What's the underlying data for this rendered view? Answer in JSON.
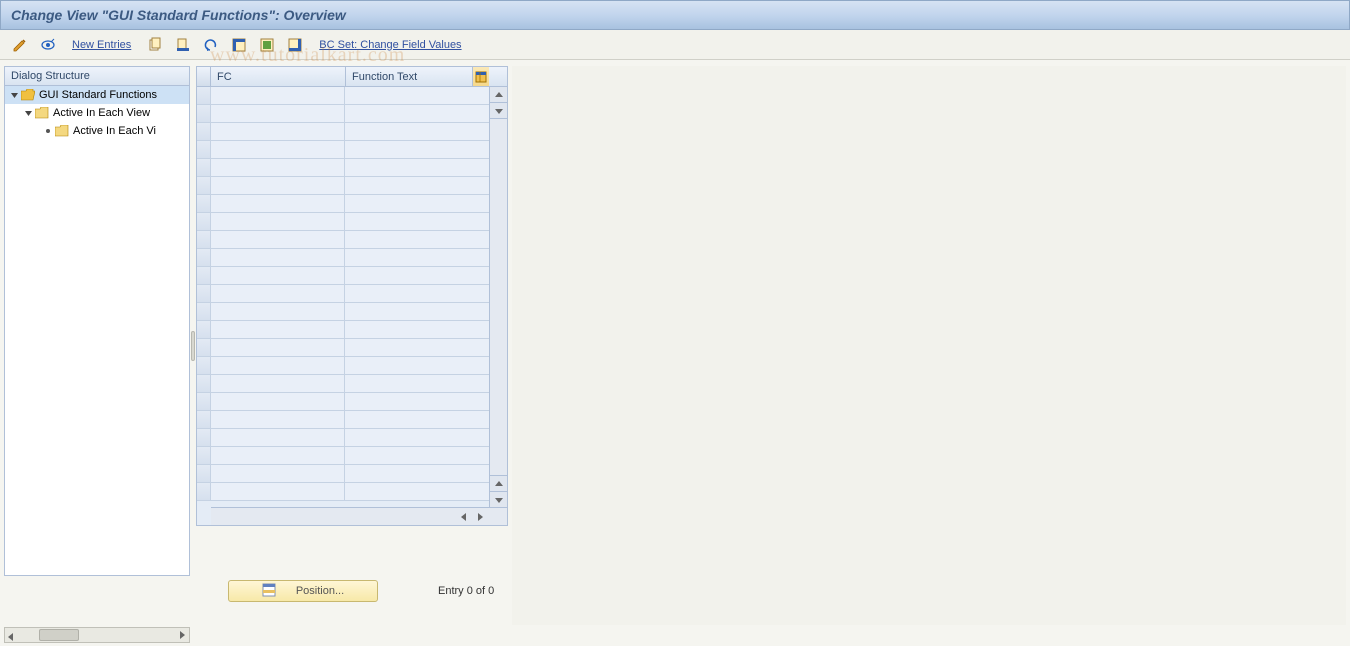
{
  "title": "Change View \"GUI Standard Functions\": Overview",
  "toolbar": {
    "new_entries": "New Entries",
    "bc_set": "BC Set: Change Field Values"
  },
  "tree": {
    "header": "Dialog Structure",
    "nodes": {
      "root": "GUI Standard Functions",
      "child1": "Active In Each View",
      "child2": "Active In Each Vi"
    }
  },
  "grid": {
    "col_fc": "FC",
    "col_ft": "Function Text"
  },
  "footer": {
    "position_btn": "Position...",
    "entry_text": "Entry 0 of 0"
  },
  "watermark": "www.tutorialkart.com"
}
